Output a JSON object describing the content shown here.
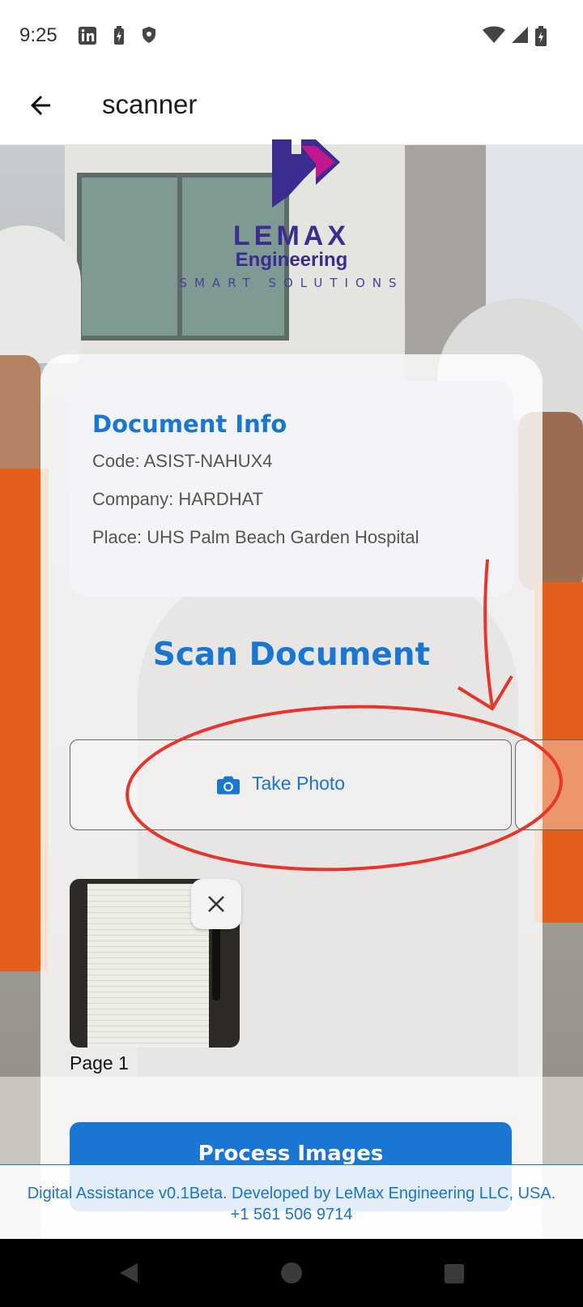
{
  "status_bar": {
    "time": "9:25",
    "left_icons": [
      "linkedin-icon",
      "battery-saver-icon",
      "shield-icon"
    ],
    "right_icons": [
      "wifi-icon",
      "signal-icon",
      "battery-icon"
    ]
  },
  "app_bar": {
    "title": "scanner",
    "back_icon": "arrow-back-icon"
  },
  "logo": {
    "line1": "LEMAX",
    "line2": "Engineering",
    "line3": "SMART SOLUTIONS",
    "colors": {
      "primary": "#3a2d8f",
      "accent": "#c2188f"
    }
  },
  "document_info": {
    "heading": "Document Info",
    "code": "Code: ASIST-NAHUX4",
    "company": "Company: HARDHAT",
    "place": "Place: UHS Palm Beach Garden Hospital"
  },
  "scan": {
    "title": "Scan Document",
    "take_photo_label": "Take Photo",
    "take_photo_icon": "camera-icon"
  },
  "pages": [
    {
      "label": "Page 1",
      "remove_icon": "close-icon"
    }
  ],
  "process_button": {
    "label": "Process Images"
  },
  "footer": {
    "text": "Digital Assistance v0.1Beta. Developed by LeMax Engineering LLC, USA. +1 561 506 9714"
  },
  "colors": {
    "accent": "#1976d2",
    "annotation": "#e8352b"
  }
}
